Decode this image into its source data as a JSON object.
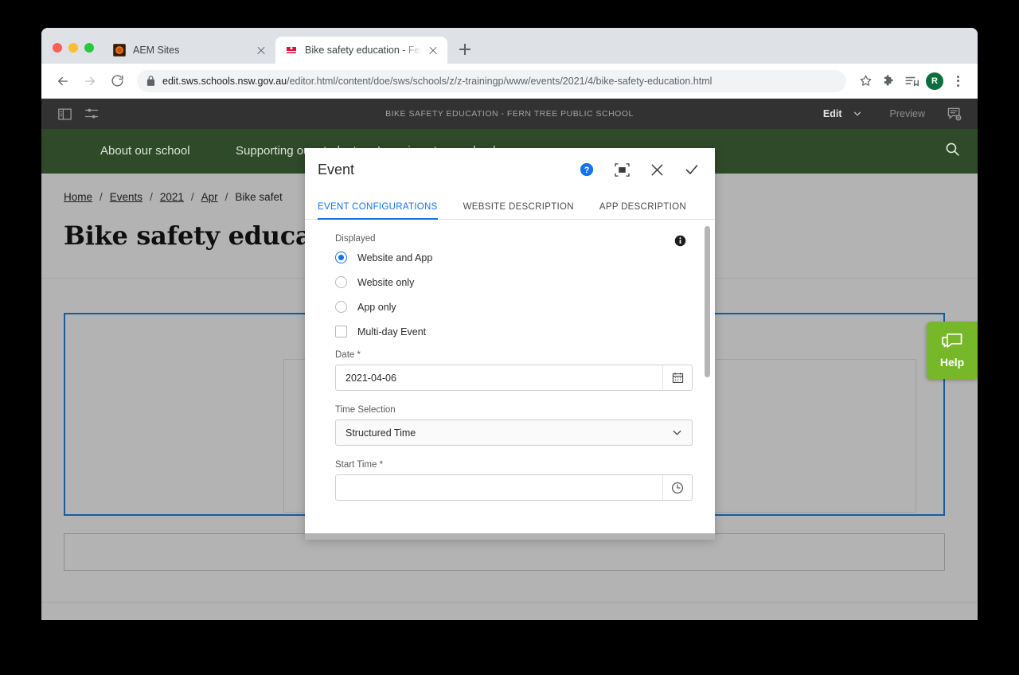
{
  "browser": {
    "tabs": [
      {
        "title": "AEM Sites",
        "favicon": "aem-icon",
        "active": false
      },
      {
        "title": "Bike safety education - Fern Tr",
        "favicon": "nsw-gov-icon",
        "active": true
      }
    ],
    "new_tab_label": "+",
    "url_strong": "edit.sws.schools.nsw.gov.au",
    "url_rest": "/editor.html/content/doe/sws/schools/z/z-trainingp/www/events/2021/4/bike-safety-education.html",
    "profile_initial": "R",
    "icons": {
      "back": "back-arrow-icon",
      "forward": "forward-arrow-icon",
      "reload": "reload-icon",
      "lock": "lock-icon",
      "bookmark": "star-icon",
      "extensions": "puzzle-piece-icon",
      "reading_list": "reading-list-icon",
      "menu": "kebab-menu-icon"
    }
  },
  "aem_toolbar": {
    "page_title": "BIKE SAFETY EDUCATION - FERN TREE PUBLIC SCHOOL",
    "edit_label": "Edit",
    "preview_label": "Preview",
    "icons": {
      "sidebar": "side-panel-icon",
      "filters": "sliders-icon",
      "annotations": "annotate-icon",
      "mode_chevron": "chevron-down-icon"
    }
  },
  "site_nav": {
    "items": [
      {
        "label": "About our school"
      },
      {
        "label": "Supporting our students"
      },
      {
        "label": "Learning at our school"
      }
    ],
    "search_icon": "search-icon",
    "background": "#2e4a28"
  },
  "breadcrumb": {
    "items": [
      {
        "label": "Home",
        "link": true
      },
      {
        "label": "Events",
        "link": true
      },
      {
        "label": "2021",
        "link": true
      },
      {
        "label": "Apr",
        "link": true
      },
      {
        "label": "Bike safet",
        "link": false
      }
    ],
    "separator": "/"
  },
  "page": {
    "heading": "Bike safety education"
  },
  "help_widget": {
    "label": "Help",
    "icon": "chat-bubble-icon",
    "color": "#76b82a"
  },
  "dialog": {
    "title": "Event",
    "actions": [
      {
        "name": "help-icon",
        "glyph": "?"
      },
      {
        "name": "fullscreen-icon",
        "glyph": "[ ]"
      },
      {
        "name": "close-icon",
        "glyph": "×"
      },
      {
        "name": "confirm-icon",
        "glyph": "✓"
      }
    ],
    "tabs": [
      {
        "label": "EVENT CONFIGURATIONS",
        "active": true
      },
      {
        "label": "WEBSITE DESCRIPTION",
        "active": false
      },
      {
        "label": "APP DESCRIPTION",
        "active": false
      }
    ],
    "form": {
      "displayed_label": "Displayed",
      "displayed_info_icon": "info-icon",
      "radio_options": [
        {
          "label": "Website and App",
          "checked": true
        },
        {
          "label": "Website only",
          "checked": false
        },
        {
          "label": "App only",
          "checked": false
        }
      ],
      "multiday": {
        "label": "Multi-day Event",
        "checked": false
      },
      "date": {
        "label": "Date *",
        "value": "2021-04-06",
        "button_icon": "calendar-icon"
      },
      "time_selection": {
        "label": "Time Selection",
        "value": "Structured Time",
        "chevron": "chevron-down-icon"
      },
      "start_time": {
        "label": "Start Time *",
        "value": "",
        "placeholder": "",
        "button_icon": "clock-icon"
      }
    },
    "accent_color": "#1473e6"
  }
}
